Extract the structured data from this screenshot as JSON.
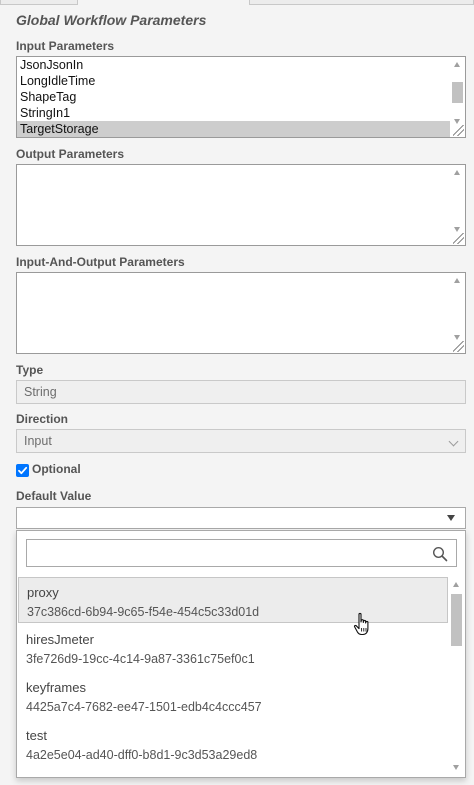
{
  "panel": {
    "title": "Global Workflow Parameters"
  },
  "input_parameters": {
    "label": "Input Parameters",
    "items": [
      "JsonJsonIn",
      "LongIdleTime",
      "ShapeTag",
      "StringIn1",
      "TargetStorage"
    ],
    "selected": "TargetStorage"
  },
  "output_parameters": {
    "label": "Output Parameters",
    "items": []
  },
  "inout_parameters": {
    "label": "Input-And-Output Parameters",
    "items": []
  },
  "type": {
    "label": "Type",
    "value": "String"
  },
  "direction": {
    "label": "Direction",
    "value": "Input"
  },
  "optional": {
    "label": "Optional",
    "checked": true
  },
  "default_value": {
    "label": "Default Value",
    "selected": "",
    "search_placeholder": "",
    "options": [
      {
        "name": "proxy",
        "id": "37c386cd-6b94-9c65-f54e-454c5c33d01d"
      },
      {
        "name": "hiresJmeter",
        "id": "3fe726d9-19cc-4c14-9a87-3361c75ef0c1"
      },
      {
        "name": "keyframes",
        "id": "4425a7c4-7682-ee47-1501-edb4c4ccc457"
      },
      {
        "name": "test",
        "id": "4a2e5e04-ad40-dff0-b8d1-9c3d53a29ed8"
      }
    ],
    "hovered_option": "proxy"
  },
  "colors": {
    "checkbox": "#0075ff",
    "selected_row": "#cdcdcd",
    "hover_row": "#ececec"
  }
}
